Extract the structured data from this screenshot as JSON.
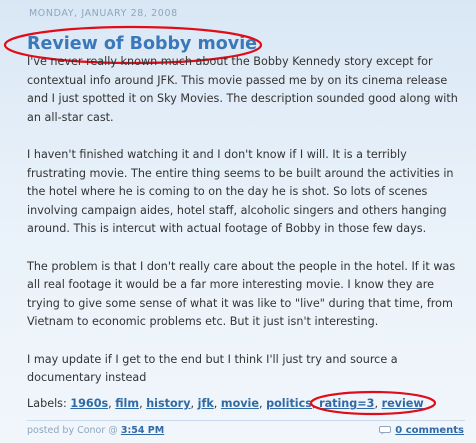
{
  "post": {
    "date_header": "Monday, January 28, 2008",
    "title": "Review of Bobby movie",
    "paragraphs": [
      "I've never really known much about the Bobby Kennedy story except for contextual info around JFK. This movie passed me by on its cinema release and I just spotted it on Sky Movies. The description sounded good along with an all-star cast.",
      "I haven't finished watching it and I don't know if I will. It is a terribly frustrating movie. The entire thing seems to be built around the activities in the hotel where he is coming to on the day he is shot. So lots of scenes involving campaign aides, hotel staff, alcoholic singers and others hanging around. This is intercut with actual footage of Bobby in those few days.",
      "The problem is that I don't really care about the people in the hotel. If it was all real footage it would be a far more interesting movie. I know they are trying to give some sense of what it was like to \"live\" during that time, from Vietnam to economic problems etc. But it just isn't interesting.",
      "I may update if I get to the end but I think I'll just try and source a documentary instead"
    ],
    "labels_prefix": "Labels:",
    "labels": [
      "1960s",
      "film",
      "history",
      "jfk",
      "movie",
      "politics",
      "rating=3",
      "review"
    ],
    "footer": {
      "posted_by_prefix": "posted by Conor @",
      "time": "3:54 PM",
      "comments": "0 comments",
      "comment_icon": "speech-bubble-icon"
    }
  },
  "colors": {
    "title": "#3a78b9",
    "link": "#2f6aa7",
    "annotation": "#e00d18",
    "meta": "#8ea6c0"
  }
}
